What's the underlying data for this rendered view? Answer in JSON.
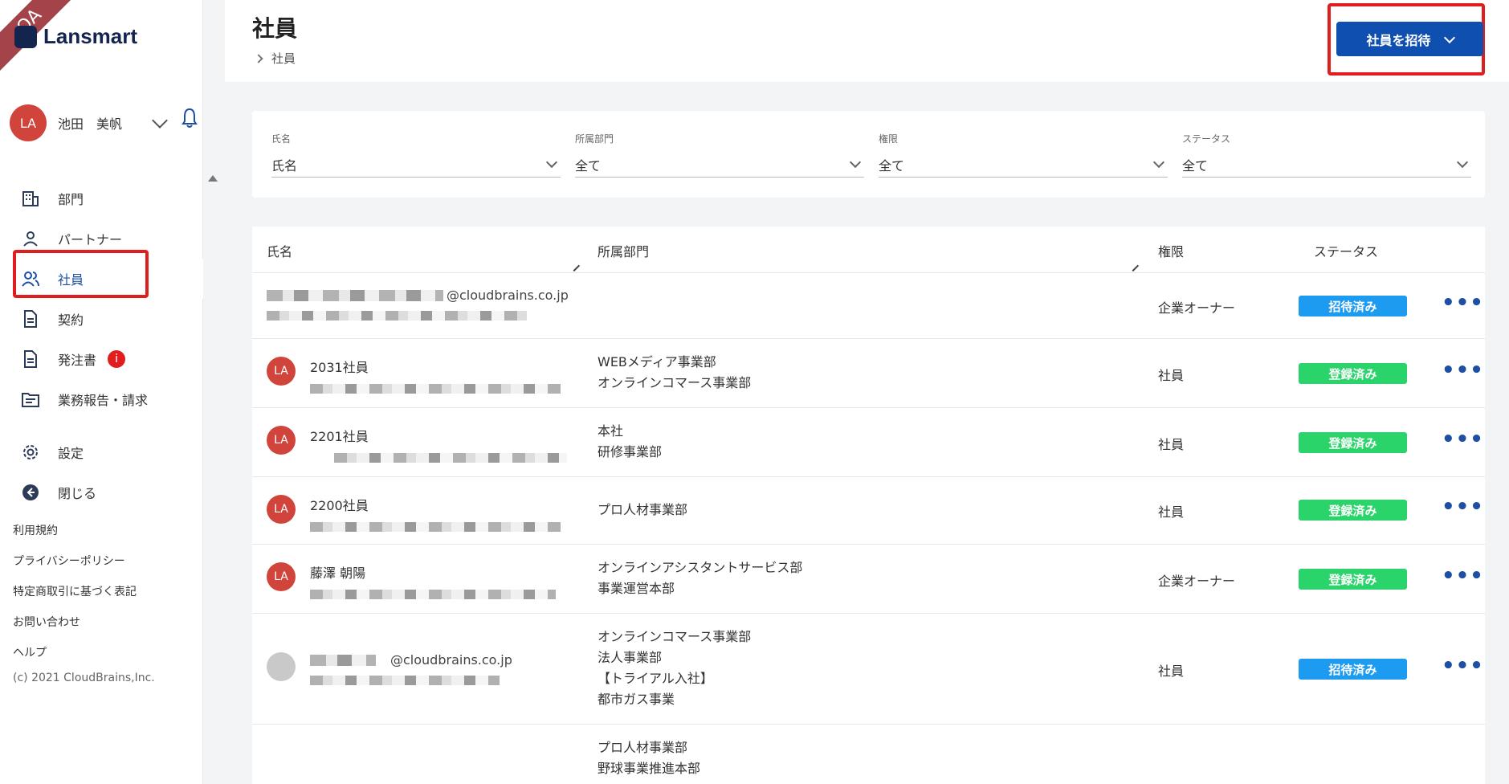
{
  "sidebar": {
    "ribbon": "QA",
    "brand": "Lansmart",
    "user": {
      "initials": "LA",
      "name": "池田　美帆"
    },
    "nav": [
      {
        "label": "部門",
        "icon": "building-icon"
      },
      {
        "label": "パートナー",
        "icon": "person-icon"
      },
      {
        "label": "社員",
        "icon": "people-icon"
      },
      {
        "label": "契約",
        "icon": "document-icon"
      },
      {
        "label": "発注書",
        "icon": "document-icon",
        "badge": "i"
      },
      {
        "label": "業務報告・請求",
        "icon": "folder-icon"
      },
      {
        "label": "設定",
        "icon": "gear-icon"
      },
      {
        "label": "閉じる",
        "icon": "arrow-left-circle-icon"
      }
    ],
    "links": [
      "利用規約",
      "プライバシーポリシー",
      "特定商取引に基づく表記",
      "お問い合わせ",
      "ヘルプ"
    ],
    "copyright": "(c) 2021 CloudBrains,Inc."
  },
  "header": {
    "title": "社員",
    "breadcrumb": "社員",
    "invite_label": "社員を招待"
  },
  "filters": [
    {
      "label": "氏名",
      "value": "氏名"
    },
    {
      "label": "所属部門",
      "value": "全て"
    },
    {
      "label": "権限",
      "value": "全て"
    },
    {
      "label": "ステータス",
      "value": "全て"
    }
  ],
  "table": {
    "columns": [
      "氏名",
      "所属部門",
      "権限",
      "ステータス"
    ],
    "rows": [
      {
        "name": "",
        "email": "@cloudbrains.co.jp",
        "avatar": "",
        "depts": [],
        "role": "企業オーナー",
        "status": "招待済み",
        "status_type": "invited"
      },
      {
        "name": "2031社員",
        "email": "",
        "avatar": "LA",
        "depts": [
          "WEBメディア事業部",
          "オンラインコマース事業部"
        ],
        "role": "社員",
        "status": "登録済み",
        "status_type": "registered"
      },
      {
        "name": "2201社員",
        "email": "",
        "avatar": "LA",
        "depts": [
          "本社",
          "研修事業部"
        ],
        "role": "社員",
        "status": "登録済み",
        "status_type": "registered"
      },
      {
        "name": "2200社員",
        "email": "",
        "avatar": "LA",
        "depts": [
          "プロ人材事業部"
        ],
        "role": "社員",
        "status": "登録済み",
        "status_type": "registered"
      },
      {
        "name": "藤澤 朝陽",
        "email": "",
        "avatar": "LA",
        "depts": [
          "オンラインアシスタントサービス部",
          "事業運営本部"
        ],
        "role": "企業オーナー",
        "status": "登録済み",
        "status_type": "registered"
      },
      {
        "name": "",
        "email": "@cloudbrains.co.jp",
        "avatar": "",
        "depts": [
          "オンラインコマース事業部",
          "法人事業部",
          "【トライアル入社】",
          "都市ガス事業"
        ],
        "role": "社員",
        "status": "招待済み",
        "status_type": "invited"
      },
      {
        "name": "",
        "email": "",
        "avatar": "",
        "depts": [
          "プロ人材事業部",
          "野球事業推進本部"
        ],
        "role": "",
        "status": "",
        "status_type": ""
      }
    ]
  },
  "more_glyph": "•••"
}
